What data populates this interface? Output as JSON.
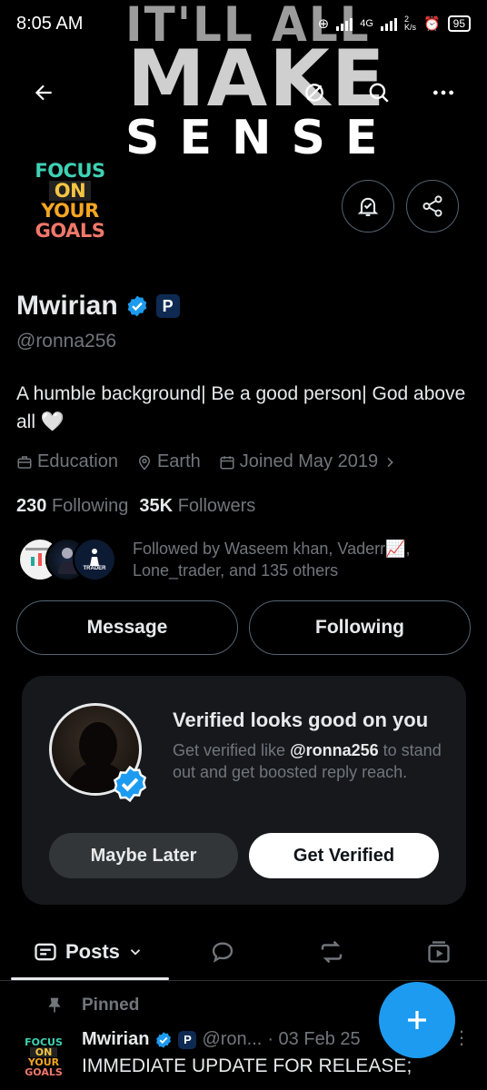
{
  "status_bar": {
    "time": "8:05 AM",
    "network": "4G",
    "speed_top": "2",
    "speed_unit": "K/s",
    "battery": "95"
  },
  "banner": {
    "line1": "IT'LL ALL",
    "line2": "MAKE",
    "line3": "SENSE"
  },
  "avatar": {
    "l1": "FOCUS",
    "l2": "ON",
    "l3": "YOUR",
    "l4": "GOALS"
  },
  "profile": {
    "name": "Mwirian",
    "badge_letter": "P",
    "handle": "@ronna256",
    "bio": "A humble background| Be a good person| God above all 🤍",
    "category": "Education",
    "location": "Earth",
    "joined": "Joined May 2019",
    "following_count": "230",
    "following_label": "Following",
    "followers_count": "35K",
    "followers_label": "Followers",
    "followed_by": "Followed by Waseem khan, Vaderr📈, Lone_trader, and 135 others",
    "follower_avatar_3_text": "TRADER"
  },
  "actions": {
    "message": "Message",
    "following": "Following"
  },
  "verified_card": {
    "title": "Verified looks good on you",
    "text_pre": "Get verified like ",
    "text_handle": "@ronna256",
    "text_post": " to stand out and get boosted reply reach.",
    "maybe_later": "Maybe Later",
    "get_verified": "Get Verified"
  },
  "tabs": {
    "posts": "Posts"
  },
  "post": {
    "pinned_label": "Pinned",
    "author": "Mwirian",
    "badge_letter": "P",
    "handle": "@ron...",
    "date": "· 03 Feb 25",
    "text": "IMMEDIATE UPDATE FOR RELEASE;",
    "more": "⋮"
  },
  "colors": {
    "accent": "#1d9bf0",
    "background": "#000000",
    "muted": "#71767b",
    "text": "#e7e9ea"
  },
  "icons": [
    "back-arrow-icon",
    "incognito-icon",
    "search-icon",
    "more-icon",
    "bell-icon",
    "share-icon",
    "verified-badge-icon",
    "briefcase-icon",
    "location-icon",
    "calendar-icon",
    "chevron-right-icon",
    "posts-icon",
    "chevron-down-icon",
    "reply-icon",
    "repost-icon",
    "media-icon",
    "pin-icon",
    "plus-icon"
  ]
}
